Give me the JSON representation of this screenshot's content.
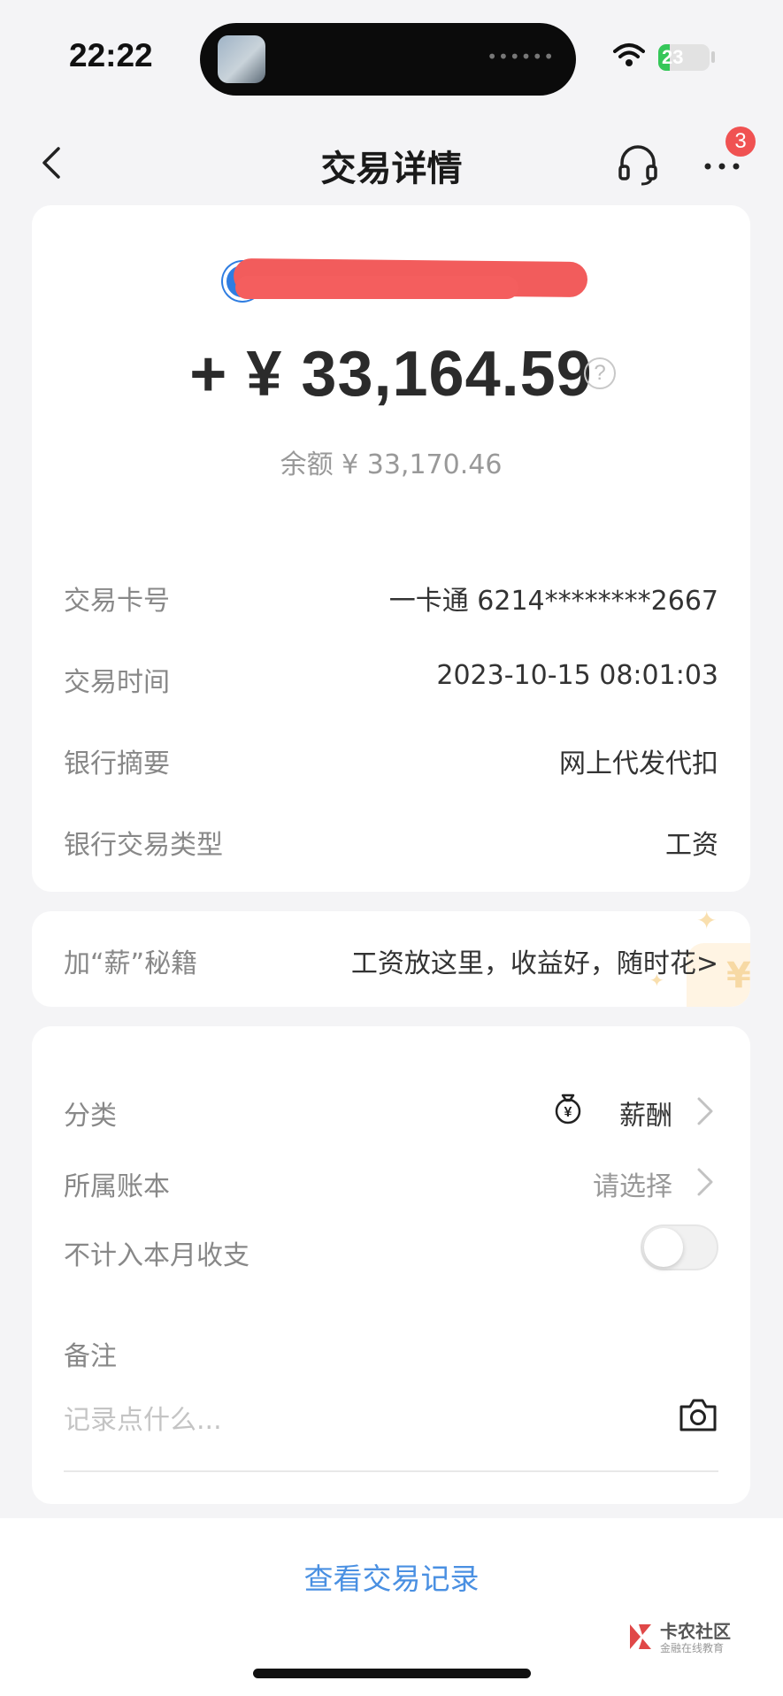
{
  "status_bar": {
    "time": "22:22",
    "battery_level": "23",
    "battery_fraction": 0.23,
    "battery_color": "#35c759"
  },
  "nav": {
    "title": "交易详情",
    "back_icon": "chevron-left-icon",
    "service_icon": "headset-icon",
    "more_icon": "more-icon",
    "notification_count": "3"
  },
  "transaction": {
    "amount": "+ ¥ 33,164.59",
    "help_symbol": "?",
    "balance": "余额 ¥ 33,170.46",
    "details": [
      {
        "label": "交易卡号",
        "value": "一卡通 6214********2667"
      },
      {
        "label": "交易时间",
        "value": "2023-10-15 08:01:03"
      },
      {
        "label": "银行摘要",
        "value": "网上代发代扣"
      },
      {
        "label": "银行交易类型",
        "value": "工资"
      }
    ]
  },
  "tip": {
    "label": "加“薪”秘籍",
    "value": "工资放这里，收益好，随时花>",
    "deco_symbol": "¥"
  },
  "settings": {
    "category_label": "分类",
    "category_value": "薪酬",
    "account_label": "所属账本",
    "account_value": "请选择",
    "exclude_label": "不计入本月收支",
    "exclude_enabled": false,
    "note_label": "备注",
    "note_placeholder": "记录点什么..."
  },
  "footer": {
    "link": "查看交易记录"
  },
  "watermark": {
    "title": "卡农社区",
    "subtitle": "金融在线教育"
  },
  "colors": {
    "accent": "#4a90e2",
    "badge": "#f05252",
    "background": "#f4f4f6"
  }
}
